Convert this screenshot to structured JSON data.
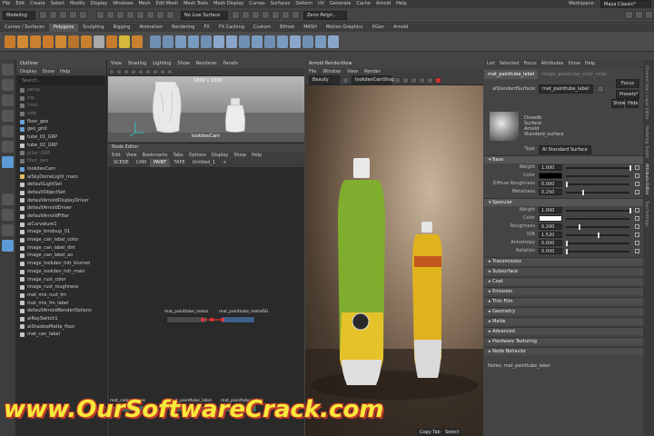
{
  "menubar": {
    "items": [
      "File",
      "Edit",
      "Create",
      "Select",
      "Modify",
      "Display",
      "Windows",
      "Mesh",
      "Edit Mesh",
      "Mesh Tools",
      "Mesh Display",
      "Curves",
      "Surfaces",
      "Deform",
      "UV",
      "Generate",
      "Cache",
      "Arnold",
      "Help"
    ],
    "workspace_label": "Workspace:",
    "workspace_value": "Maya Classic*"
  },
  "statusline": {
    "mode": "Modeling",
    "live_surface": "No Live Surface",
    "render": "Zeno Pelgri..."
  },
  "shelf_tabs": [
    "Curves / Surfaces",
    "Polygons",
    "Sculpting",
    "Rigging",
    "Animation",
    "Rendering",
    "FX",
    "FX Caching",
    "Custom",
    "Bifrost",
    "MASH",
    "Motion Graphics",
    "XGen",
    "Arnold"
  ],
  "shelf_active": "Polygons",
  "outliner": {
    "title": "Outliner",
    "menu": [
      "Display",
      "Show",
      "Help"
    ],
    "search_placeholder": "Search...",
    "items": [
      {
        "label": "persp",
        "dim": true,
        "color": "#777"
      },
      {
        "label": "top",
        "dim": true,
        "color": "#777"
      },
      {
        "label": "front",
        "dim": true,
        "color": "#777"
      },
      {
        "label": "side",
        "dim": true,
        "color": "#777"
      },
      {
        "label": "floor_geo",
        "dim": false,
        "color": "#6aa0d8"
      },
      {
        "label": "geo_grid",
        "dim": false,
        "color": "#6aa0d8"
      },
      {
        "label": "tube_01_GRP",
        "dim": false,
        "color": "#c9c9c9"
      },
      {
        "label": "tube_02_GRP",
        "dim": false,
        "color": "#c9c9c9"
      },
      {
        "label": "pillar_GRP",
        "dim": true,
        "color": "#777"
      },
      {
        "label": "floor_geo",
        "dim": true,
        "color": "#777"
      },
      {
        "label": "lookdevCam",
        "dim": false,
        "color": "#6aa0d8"
      },
      {
        "label": "aiSkyDomeLight_main",
        "dim": false,
        "color": "#e0c060"
      },
      {
        "label": "defaultLightSet",
        "dim": false,
        "color": "#c9c9c9"
      },
      {
        "label": "defaultObjectSet",
        "dim": false,
        "color": "#c9c9c9"
      },
      {
        "label": "defaultArnoldDisplayDriver",
        "dim": false,
        "color": "#c9c9c9"
      },
      {
        "label": "defaultArnoldDriver",
        "dim": false,
        "color": "#c9c9c9"
      },
      {
        "label": "defaultArnoldFilter",
        "dim": false,
        "color": "#c9c9c9"
      },
      {
        "label": "aiCurvature1",
        "dim": false,
        "color": "#c9c9c9"
      },
      {
        "label": "image_bmdsup_01",
        "dim": false,
        "color": "#c9c9c9"
      },
      {
        "label": "image_can_label_color",
        "dim": false,
        "color": "#c9c9c9"
      },
      {
        "label": "image_can_label_dirt",
        "dim": false,
        "color": "#c9c9c9"
      },
      {
        "label": "image_can_label_ao",
        "dim": false,
        "color": "#c9c9c9"
      },
      {
        "label": "image_lookdev_hdr_blurred",
        "dim": false,
        "color": "#c9c9c9"
      },
      {
        "label": "image_lookdev_hdr_main",
        "dim": false,
        "color": "#c9c9c9"
      },
      {
        "label": "image_rust_color",
        "dim": false,
        "color": "#c9c9c9"
      },
      {
        "label": "image_rust_roughness",
        "dim": false,
        "color": "#c9c9c9"
      },
      {
        "label": "mat_mix_rust_fm",
        "dim": false,
        "color": "#c9c9c9"
      },
      {
        "label": "mat_mix_fm_label",
        "dim": false,
        "color": "#c9c9c9"
      },
      {
        "label": "defaultArnoldRenderOptions",
        "dim": false,
        "color": "#c9c9c9"
      },
      {
        "label": "aiRaySwitch1",
        "dim": false,
        "color": "#c9c9c9"
      },
      {
        "label": "aiShadowMatte_floor",
        "dim": false,
        "color": "#c9c9c9"
      },
      {
        "label": "mat_can_label",
        "dim": false,
        "color": "#c9c9c9"
      }
    ]
  },
  "viewport": {
    "menu": [
      "View",
      "Shading",
      "Lighting",
      "Show",
      "Renderer",
      "Panels"
    ],
    "resolution": "1800 x 1800",
    "camera": "lookdevCam"
  },
  "node_editor": {
    "title": "Node Editor",
    "menu": [
      "Edit",
      "View",
      "Bookmarks",
      "Tabs",
      "Options",
      "Display",
      "Show",
      "Help"
    ],
    "tabs": [
      "SCENE",
      "CAM",
      "PAINT",
      "TAPE",
      "Untitled_1",
      "+"
    ],
    "active_tab": "PAINT",
    "nodes": [
      "mat_painttube_metal",
      "mat_painttube_metalSG"
    ],
    "bottom_nodes": [
      "mat_color_cabels",
      "mat_painttube_label",
      "mat_painttube_label"
    ]
  },
  "render_view": {
    "title": "Arnold RenderView",
    "menu": [
      "File",
      "Window",
      "View",
      "Render"
    ],
    "display": "Beauty",
    "camera": "lookdevCamShape"
  },
  "attribute_editor": {
    "tabs": [
      "List",
      "Selected",
      "Focus",
      "Attributes",
      "Show",
      "Help"
    ],
    "node_tab": "mat_painttube_label",
    "node_tab2": "image_painttube_color_color",
    "field_label": "aiStandardSurface:",
    "field_value": "mat_painttube_label",
    "focus_btn": "Focus",
    "presets_btn": "Presets*",
    "show_btn": "Show",
    "hide_btn": "Hide",
    "thumb_caption": [
      "Drawdb",
      "Surface",
      "Arnold",
      "Standard_surface"
    ],
    "type_label": "Type",
    "type_value": "AI Standard Surface",
    "base_section": "Base",
    "base_fields": [
      {
        "label": "Weight",
        "value": "1.000",
        "fill": 1.0
      },
      {
        "label": "Color",
        "value": "",
        "fill": null
      },
      {
        "label": "Diffuse Roughness",
        "value": "0.000",
        "fill": 0.0
      },
      {
        "label": "Metalness",
        "value": "0.250",
        "fill": 0.25
      }
    ],
    "specular_section": "Specular",
    "specular_fields": [
      {
        "label": "Weight",
        "value": "1.000",
        "fill": 1.0
      },
      {
        "label": "Color",
        "value": "",
        "fill": null
      },
      {
        "label": "Roughness",
        "value": "0.200",
        "fill": 0.2
      },
      {
        "label": "IOR",
        "value": "1.520",
        "fill": 0.5
      },
      {
        "label": "Anisotropy",
        "value": "0.000",
        "fill": 0.0
      },
      {
        "label": "Rotation",
        "value": "0.000",
        "fill": 0.0
      }
    ],
    "closed_sections": [
      "Transmission",
      "Subsurface",
      "Coat",
      "Emission",
      "Thin Film",
      "Geometry",
      "Matte",
      "Advanced",
      "Hardware Texturing",
      "Node Behavior"
    ],
    "notes": "Notes: mat_painttube_label"
  },
  "sidebar_tabs": [
    "Channel Box / Layer Editor",
    "Modeling Toolkit",
    "Attribute Editor",
    "Tool Settings"
  ],
  "watermark": "www.OurSoftwareCrack.com",
  "bottom_buttons": [
    "Copy Tab",
    "Select"
  ]
}
